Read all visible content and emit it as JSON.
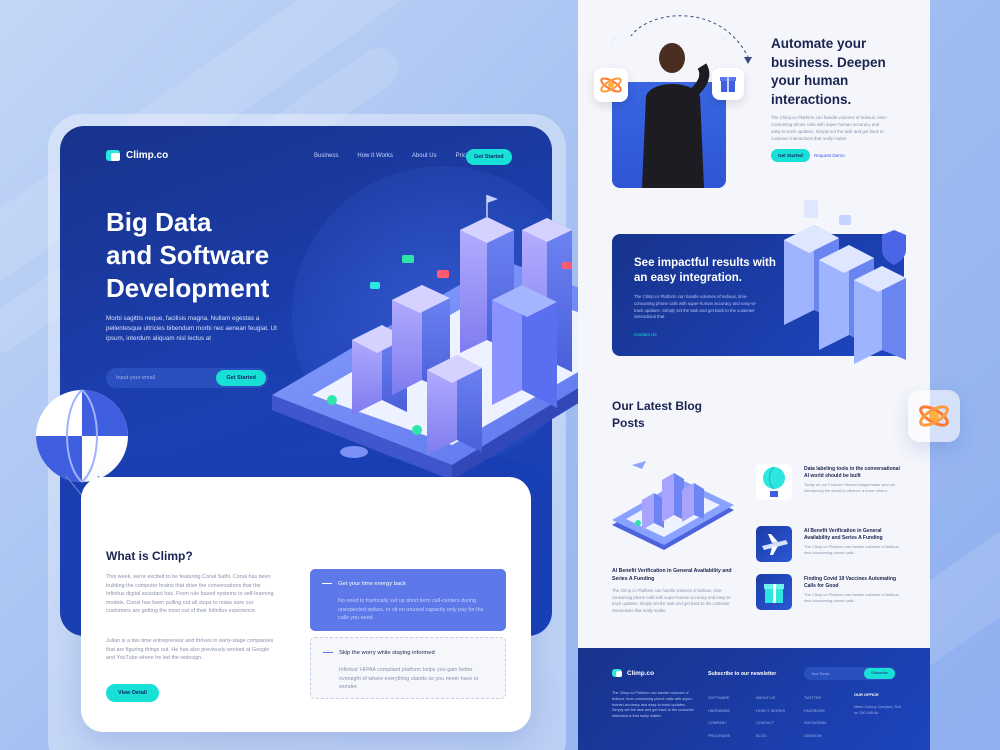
{
  "brand": {
    "name": "Climp.co"
  },
  "nav": {
    "links": [
      "Business",
      "How It Works",
      "About Us",
      "Pricing"
    ],
    "cta": "Get Started"
  },
  "hero": {
    "title_lines": [
      "Big Data",
      "and Software",
      "Development"
    ],
    "description": "Morbi sagittis neque, facilisis magna. Nullam egestas a pellentesque ultricies bibendum morbi nec aenean feugiat. Ut ipsum, interdum aliquam nisl lectus at",
    "email_placeholder": "Input your email",
    "email_button": "Get Started"
  },
  "about": {
    "title": "What is Climp?",
    "paragraph1": "This week, we're excited to be featuring Conal Sathi. Conal has been building the computer brains that drive the conversations that the Infinitus digital assistant has. From rule based systems to self-learning models, Conal has been pulling out all stops to make sure our customers are getting the most out of their Infinitus experience.",
    "paragraph2": "Julian is a two time entrepreneur and thrives in early-stage companies that are figuring things out. He has also previously worked at Google and YouTube where he led the redesign.",
    "button": "View Detail",
    "features": [
      {
        "title": "Get your time energy back",
        "body": "No need to frantically set up short term call-centers during unexpected spikes, or sit on unused capacity only pay for the calls you need."
      },
      {
        "title": "Skip the worry while staying informed",
        "body": "Infinitus' HIPAA compliant platform helps you gain better oversight of where everything stands so you never have to wonder."
      }
    ]
  },
  "automate": {
    "title": "Automate your business. Deepen your human interactions.",
    "description": "The Climp.co Platform can handle volumes of tedious, time-consuming phone calls with super-human accuracy and easy-to-track updates. Simply set the task and get back to customer interactions that really matter.",
    "button": "Get Started",
    "link": "Request Demo"
  },
  "results": {
    "title": "See impactful results with an easy integration.",
    "description": "The Climp.co Platform can handle volumes of tedious, time-consuming phone calls with super-human accuracy and easy-to-track updates. Simply set the task and get back to the customer interactions that",
    "link": "Contact Us"
  },
  "blog": {
    "title": "Our Latest Blog Posts",
    "main_post": {
      "title": "AI Benefit Verification in General Availability and Series A Funding",
      "description": "The Climp.co Platform can handle volumes of tedious, time-consuming phone calls with super-human accuracy and easy-to-track updates. Simply set the task and get back to the customer interactions that really matter."
    },
    "posts": [
      {
        "title": "Data labeling tools in the conversational AI world should be built",
        "description": "Today on our Founder Stream Mappercase who we introducing the world to offshore a team reform."
      },
      {
        "title": "AI Benefit Verification in General Availability and Series A Funding",
        "description": "The Climp.co Platform can handle volumes of tedious, time-consuming phone calls ..."
      },
      {
        "title": "Finding Covid 19 Vaccines Automating Calls for Good",
        "description": "The Climp.co Platform can handle volumes of tedious, time-consuming phone calls ..."
      }
    ]
  },
  "footer": {
    "brand": "Climp.co",
    "description": "The Climp.co Platform can handle volumes of tedious, time-consuming phone calls with super-human accuracy and easy-to-track updates. Simply set the task and get back to the customer interactions that really matter.",
    "subscribe_title": "Subscribe to our newsletter",
    "email_placeholder": "Your Email",
    "subscribe_button": "Subscribe",
    "columns": [
      [
        "SOFTWARE",
        "HARDWARE",
        "COMPANY",
        "PROGRAMS"
      ],
      [
        "ABOUT US",
        "HOW IT WORKS",
        "CONTACT",
        "BLOG"
      ],
      [
        "TWITTER",
        "FACEBOOK",
        "INSTAGRAM",
        "LINKEDIN"
      ]
    ],
    "office_title": "OUR OFFICE",
    "office_address": "Mario Colony Complex, Sch on 290 345 Ak"
  },
  "colors": {
    "primary_dark": "#17338c",
    "primary": "#1e46c2",
    "accent": "#19e0d6",
    "text_dark": "#1b2450",
    "text_muted": "#8a93ad"
  },
  "icons": [
    "balloon-illustration",
    "isometric-city-illustration",
    "server-illustration",
    "atom-icon",
    "gift-icon"
  ]
}
